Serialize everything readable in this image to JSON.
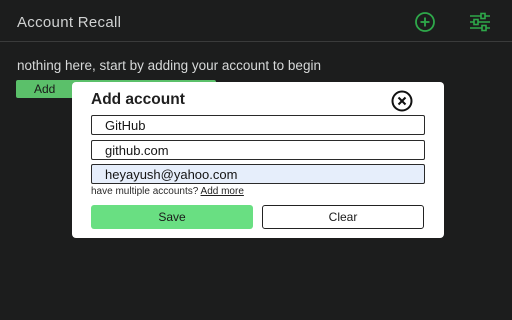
{
  "header": {
    "title": "Account Recall",
    "add_icon": "plus-circle-icon",
    "settings_icon": "sliders-icon",
    "accent_color": "#2ea84a"
  },
  "main": {
    "empty_message": "nothing here, start by adding your account to begin",
    "add_button_label": "Add"
  },
  "modal": {
    "title": "Add account",
    "close_icon": "close-circle-icon",
    "fields": {
      "name": "GitHub",
      "url": "github.com",
      "email": "heyayush@yahoo.com"
    },
    "helper_text": "have multiple accounts?",
    "helper_link": "Add more",
    "save_label": "Save",
    "clear_label": "Clear",
    "save_color": "#69df82"
  }
}
